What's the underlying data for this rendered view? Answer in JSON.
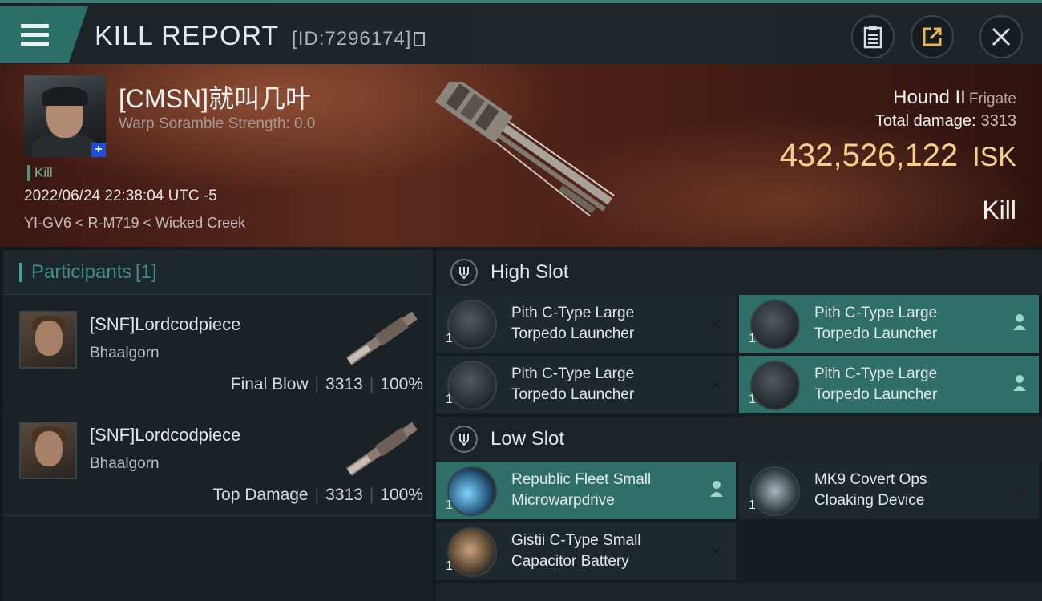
{
  "header": {
    "title": "KILL REPORT",
    "report_id": "[ID:7296174]",
    "icons": [
      "menu-icon",
      "clipboard-icon",
      "share-icon",
      "close-icon"
    ]
  },
  "victim": {
    "name": "[CMSN]就叫几叶",
    "scramble": "Warp Soramble Strength: 0.0",
    "tag": "Kill",
    "datetime": "2022/06/24 22:38:04 UTC -5",
    "location": "YI-GV6 < R-M719 < Wicked Creek",
    "ship_name": "Hound II",
    "ship_class": "Frigate",
    "total_damage_label": "Total damage:",
    "total_damage": "3313",
    "isk_value": "432,526,122",
    "isk_unit": "ISK",
    "result": "Kill"
  },
  "participants": {
    "title": "Participants",
    "count": "[1]",
    "rows": [
      {
        "name": "[SNF]Lordcodpiece",
        "ship": "Bhaalgorn",
        "role": "Final Blow",
        "damage": "3313",
        "percent": "100%"
      },
      {
        "name": "[SNF]Lordcodpiece",
        "ship": "Bhaalgorn",
        "role": "Top Damage",
        "damage": "3313",
        "percent": "100%"
      }
    ]
  },
  "slots": {
    "high": {
      "label": "High Slot",
      "items": [
        {
          "qty": "1",
          "line1": "Pith C-Type Large",
          "line2": "Torpedo Launcher",
          "state": "destroyed"
        },
        {
          "qty": "1",
          "line1": "Pith C-Type Large",
          "line2": "Torpedo Launcher",
          "state": "dropped"
        },
        {
          "qty": "1",
          "line1": "Pith C-Type Large",
          "line2": "Torpedo Launcher",
          "state": "destroyed"
        },
        {
          "qty": "1",
          "line1": "Pith C-Type Large",
          "line2": "Torpedo Launcher",
          "state": "dropped"
        }
      ]
    },
    "low": {
      "label": "Low Slot",
      "items": [
        {
          "qty": "1",
          "line1": "Republic Fleet Small",
          "line2": "Microwarpdrive",
          "state": "dropped"
        },
        {
          "qty": "1",
          "line1": "MK9 Covert Ops",
          "line2": "Cloaking Device",
          "state": "destroyed"
        },
        {
          "qty": "1",
          "line1": "Gistii C-Type Small",
          "line2": "Capacitor Battery",
          "state": "destroyed"
        }
      ]
    },
    "destroyed_mark": "✕"
  },
  "colors": {
    "accent": "#2f6f67",
    "isk": "#f6cf8a",
    "kill_tag": "#6ab59e"
  }
}
